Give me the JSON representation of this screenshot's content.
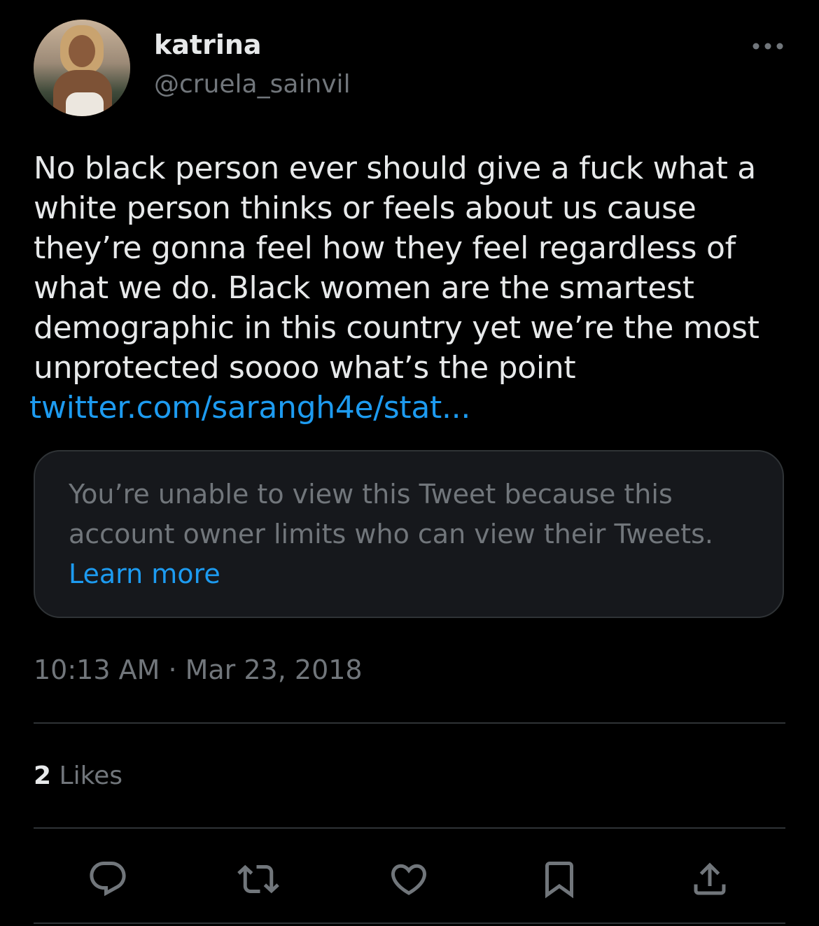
{
  "author": {
    "display_name": "katrina",
    "handle": "@cruela_sainvil"
  },
  "tweet": {
    "text": "No black person ever should give a fuck what a\nwhite person thinks or feels about us cause\nthey’re gonna feel how they feel regardless of\nwhat we do. Black women are the smartest\ndemographic in this country yet we’re the most\nunprotected soooo what’s the point",
    "link_text": "twitter.com/sarangh4e/stat...",
    "timestamp": "10:13 AM · Mar 23, 2018"
  },
  "quoted_tweet": {
    "message": "You’re unable to view this Tweet because this account owner limits who can view their Tweets.",
    "learn_more_label": "Learn more"
  },
  "stats": {
    "likes_count": "2",
    "likes_label": "Likes"
  },
  "actions": [
    {
      "icon": "reply-icon"
    },
    {
      "icon": "retweet-icon"
    },
    {
      "icon": "like-icon"
    },
    {
      "icon": "bookmark-icon"
    },
    {
      "icon": "share-icon"
    }
  ],
  "colors": {
    "background": "#000000",
    "primary_text": "#e7e9ea",
    "secondary_text": "#71767b",
    "link": "#1d9bf0",
    "card_background": "#16181c",
    "border": "#2f3336"
  }
}
